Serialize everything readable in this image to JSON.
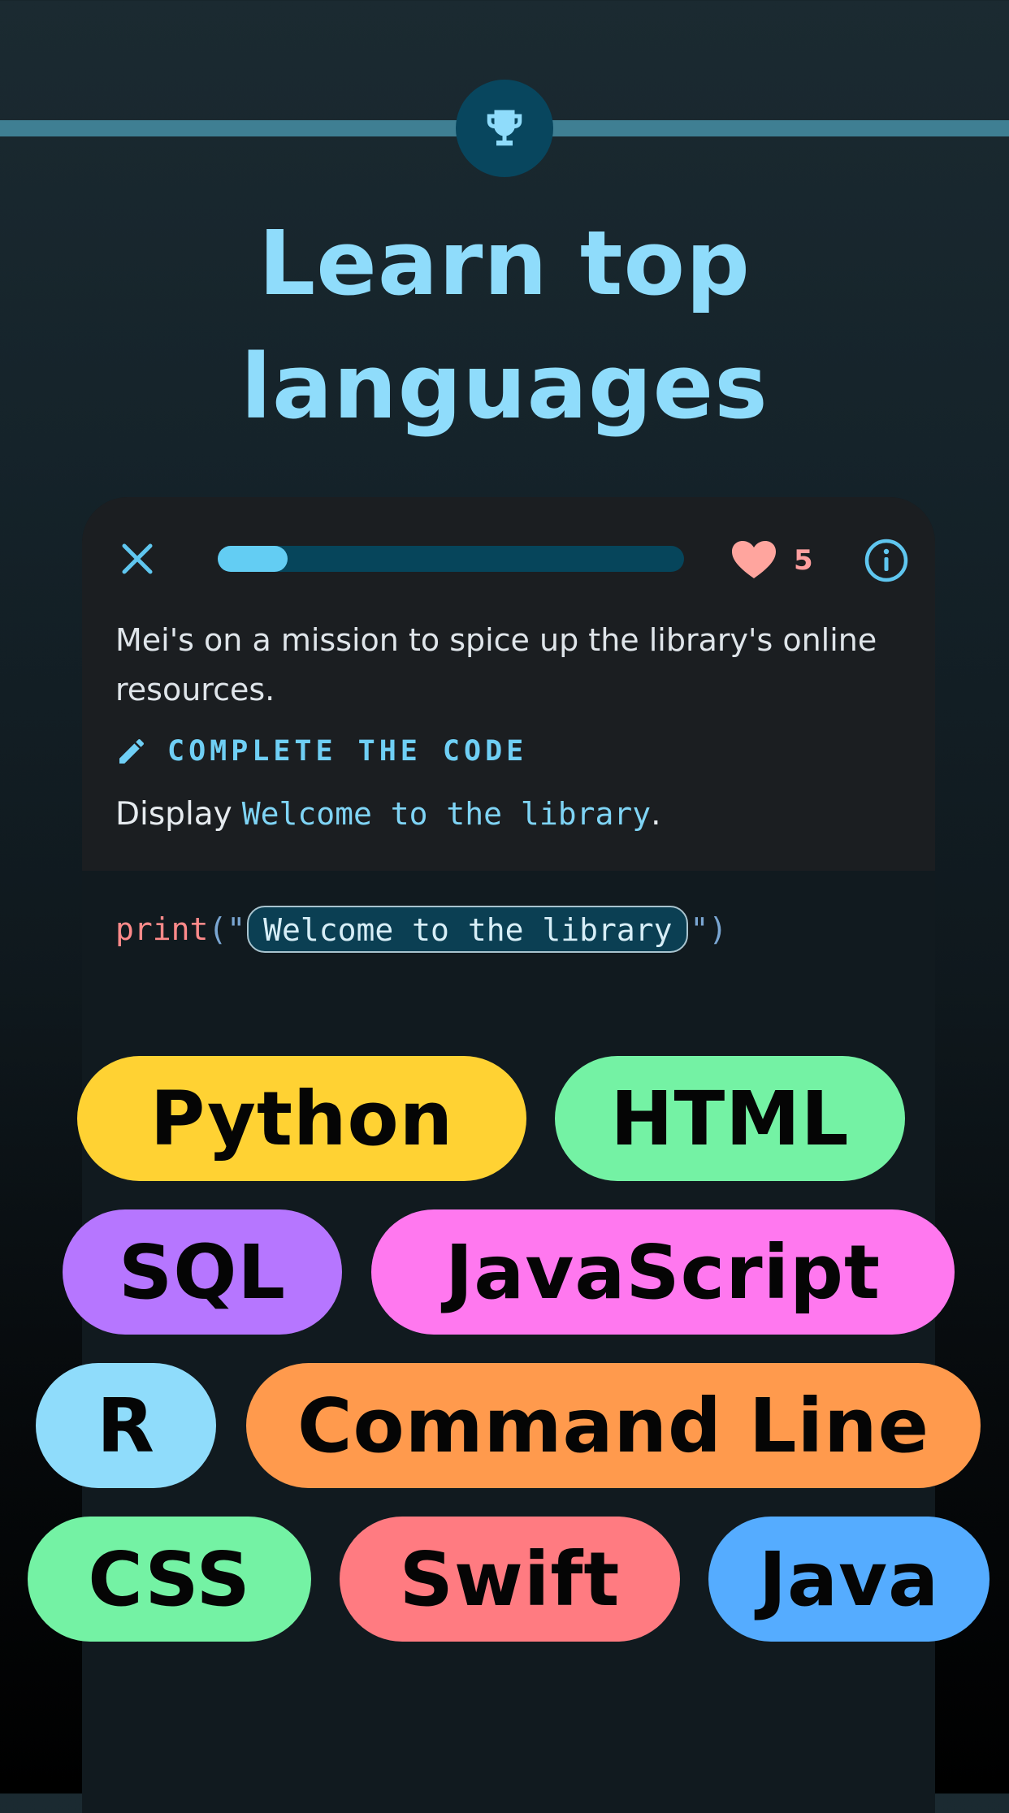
{
  "header": {
    "headline": "Learn top languages",
    "badge_icon": "trophy-icon"
  },
  "lesson": {
    "progress": 0.15,
    "hearts": "5",
    "story": "Mei's on a mission to spice up the library's online resources.",
    "instruction_label": "COMPLETE THE CODE",
    "task_prefix": "Display",
    "task_code": "Welcome to the library",
    "task_suffix": ".",
    "code": {
      "function": "print",
      "open": "(\"",
      "answer": "Welcome to the library",
      "close": "\")"
    }
  },
  "languages": [
    {
      "label": "Python",
      "color": "#ffd233"
    },
    {
      "label": "HTML",
      "color": "#74f2a4"
    },
    {
      "label": "SQL",
      "color": "#b676ff"
    },
    {
      "label": "JavaScript",
      "color": "#ff78ef"
    },
    {
      "label": "R",
      "color": "#8fdcfb"
    },
    {
      "label": "Command Line",
      "color": "#ff9a4d"
    },
    {
      "label": "CSS",
      "color": "#74f2a4"
    },
    {
      "label": "Swift",
      "color": "#ff7b81"
    },
    {
      "label": "Java",
      "color": "#55acff"
    }
  ],
  "colors": {
    "accent": "#8fdcfb",
    "heart": "#ff9f9f",
    "progress_fill": "#63cdf3",
    "progress_track": "#06455b"
  }
}
